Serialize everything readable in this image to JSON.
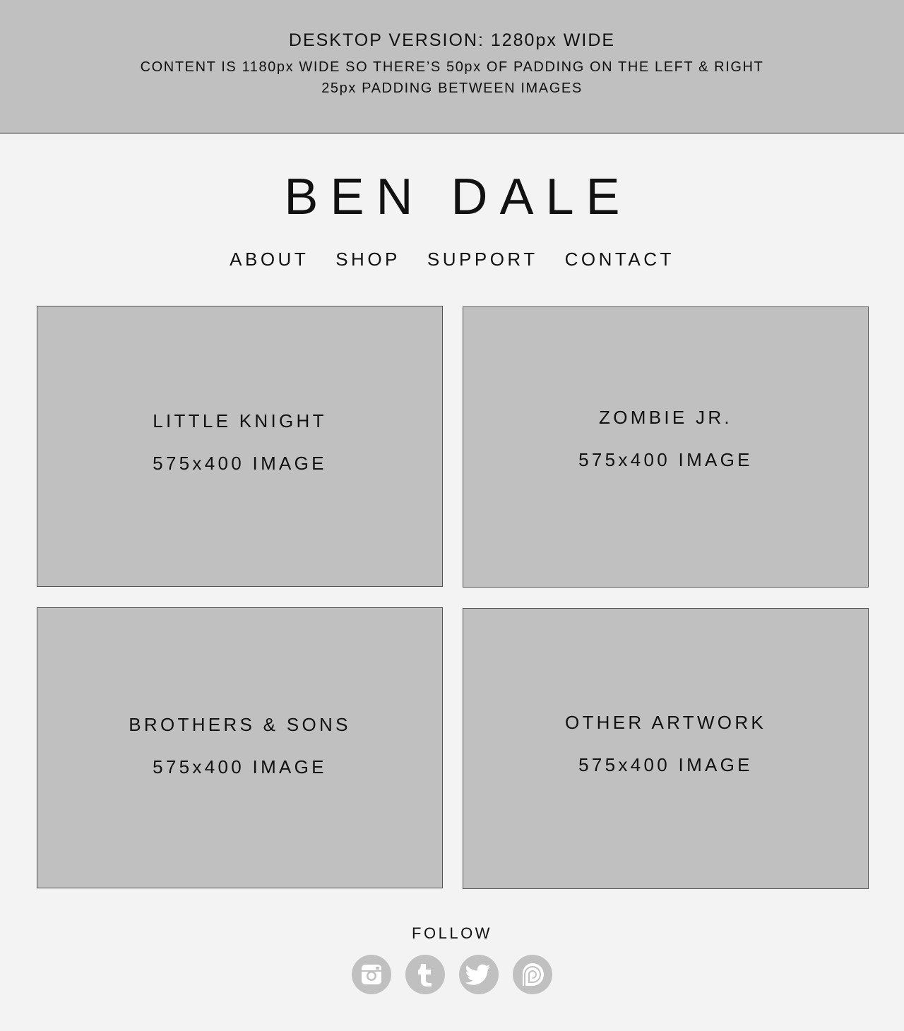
{
  "info_banner": {
    "title": "DESKTOP VERSION: 1280px WIDE",
    "line1": "CONTENT IS 1180px WIDE SO THERE’S 50px OF PADDING ON THE LEFT & RIGHT",
    "line2": "25px PADDING BETWEEN IMAGES"
  },
  "brand": {
    "name": "BEN DALE"
  },
  "nav": {
    "items": [
      {
        "label": "ABOUT"
      },
      {
        "label": "SHOP"
      },
      {
        "label": "SUPPORT"
      },
      {
        "label": "CONTACT"
      }
    ]
  },
  "gallery": {
    "cards": [
      {
        "title": "LITTLE KNIGHT",
        "caption": "575x400 IMAGE"
      },
      {
        "title": "ZOMBIE JR.",
        "caption": "575x400 IMAGE"
      },
      {
        "title": "BROTHERS & SONS",
        "caption": "575x400 IMAGE"
      },
      {
        "title": "OTHER ARTWORK",
        "caption": "575x400 IMAGE"
      }
    ]
  },
  "footer": {
    "follow_label": "FOLLOW",
    "social": [
      {
        "icon": "instagram-icon"
      },
      {
        "icon": "tumblr-icon"
      },
      {
        "icon": "twitter-icon"
      },
      {
        "icon": "patreon-icon"
      }
    ]
  },
  "colors": {
    "page_background": "#f3f3f3",
    "banner_background": "#c0c0c0",
    "placeholder": "#c0c0c0",
    "icon_glyph": "#ffffff",
    "text": "#111111"
  }
}
